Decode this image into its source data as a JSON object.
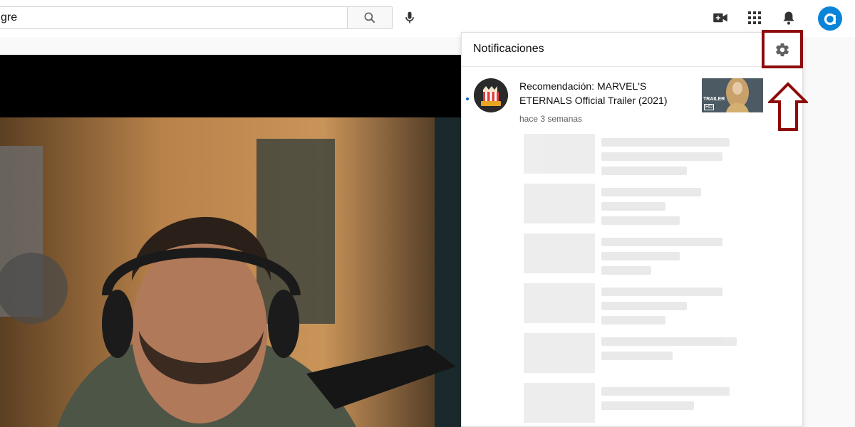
{
  "search": {
    "value": "gre",
    "placeholder": ""
  },
  "icons": {
    "search": "search-icon",
    "mic": "mic-icon",
    "create": "video-camera-plus-icon",
    "apps": "apps-grid-icon",
    "bell": "bell-icon",
    "avatar": "avatar-a-icon",
    "gear": "gear-icon"
  },
  "avatar": {
    "letter": "a",
    "color": "#0a84d8"
  },
  "notifications": {
    "title": "Notificaciones",
    "items": [
      {
        "text": "Recomendación: MARVEL'S ETERNALS Official Trailer (2021)",
        "time": "hace 3 semanas",
        "thumb_badge_top": "TRAILER",
        "thumb_badge_bottom": "HD",
        "unread": true
      }
    ]
  },
  "colors": {
    "highlight": "#8e0b0b",
    "unread_dot": "#065fd4"
  }
}
